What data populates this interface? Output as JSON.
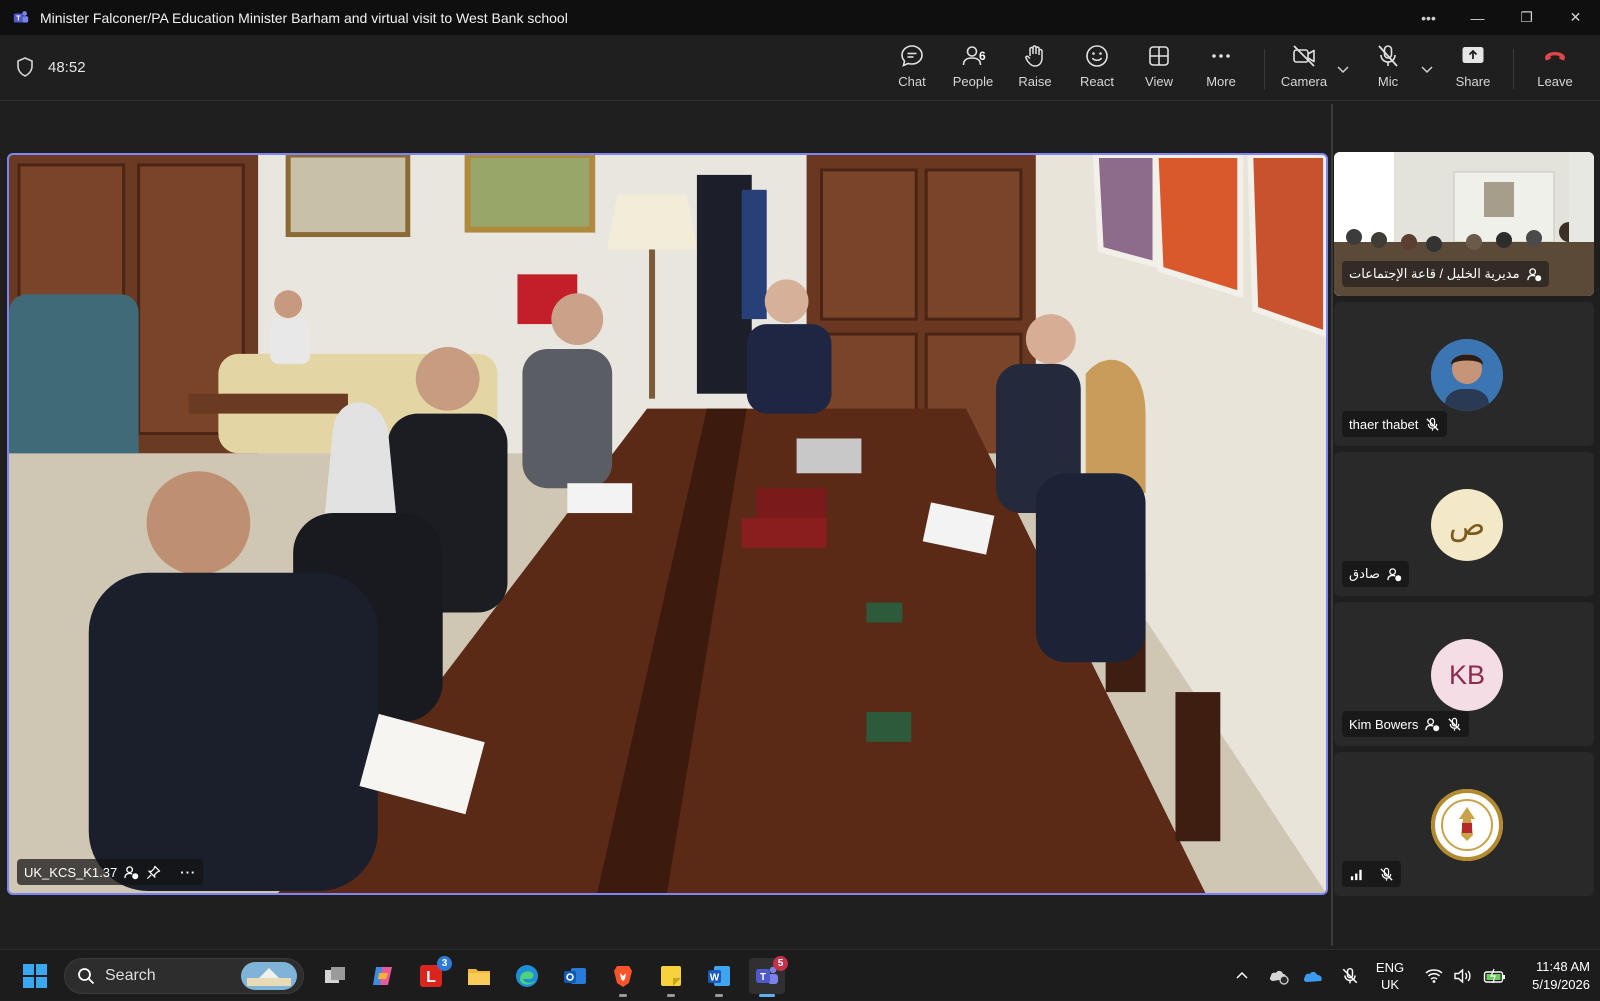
{
  "window": {
    "title": "Minister Falconer/PA Education Minister Barham and virtual visit to West Bank school"
  },
  "toolbar": {
    "timer": "48:52",
    "chat_label": "Chat",
    "people_label": "People",
    "people_count": "6",
    "raise_label": "Raise",
    "react_label": "React",
    "view_label": "View",
    "more_label": "More",
    "camera_label": "Camera",
    "mic_label": "Mic",
    "share_label": "Share",
    "leave_label": "Leave"
  },
  "main_video": {
    "participant_name": "UK_KCS_K1.37"
  },
  "participants": [
    {
      "name": "مديرية الخليل / قاعة الإجتماعات",
      "type": "video"
    },
    {
      "name": "thaer thabet",
      "type": "photo",
      "muted": true
    },
    {
      "name": "صادق",
      "initials": "ص",
      "type": "initials",
      "avatar_color": "#f3e9c8",
      "text_color": "#7b5a1b"
    },
    {
      "name": "Kim Bowers",
      "initials": "KB",
      "type": "initials",
      "avatar_color": "#f5dde6",
      "text_color": "#8e2a4f",
      "muted": true
    },
    {
      "name": "",
      "type": "emblem",
      "muted": true
    }
  ],
  "taskbar": {
    "search_placeholder": "Search",
    "lens_badge": "3",
    "teams_badge": "5",
    "lang_line1": "ENG",
    "lang_line2": "UK",
    "time": "11:48 AM",
    "date": "5/19/2026"
  },
  "colors": {
    "accent": "#7f85f5",
    "leave": "#e0474d",
    "badge": "#c4314b"
  }
}
